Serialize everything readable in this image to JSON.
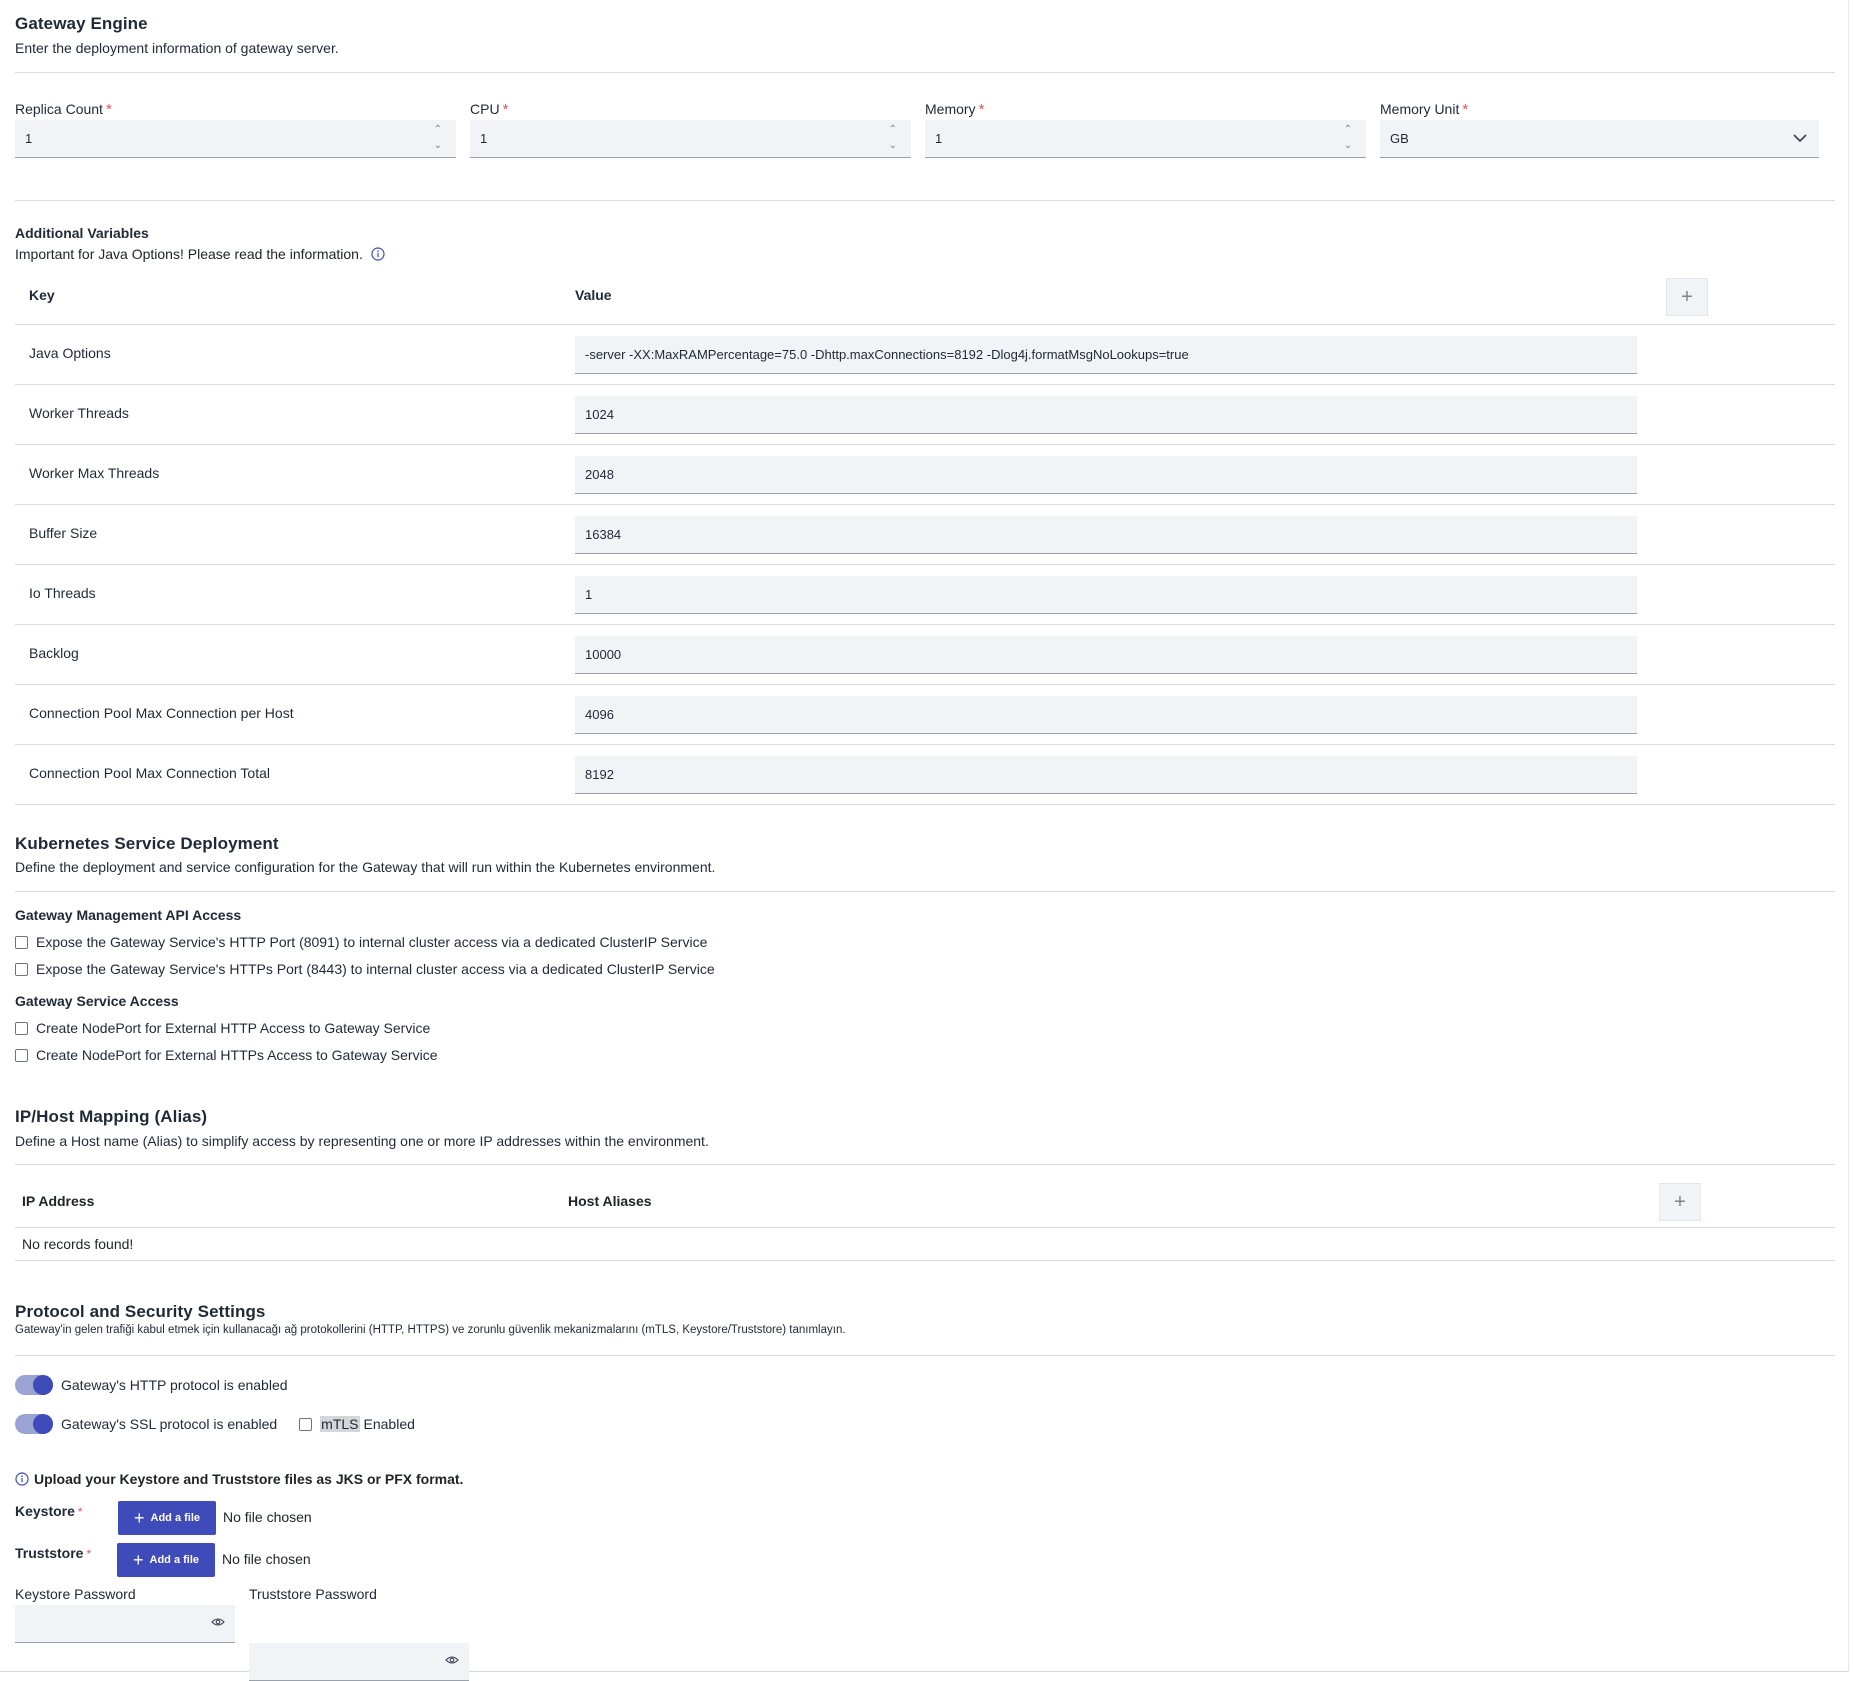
{
  "gateway_engine": {
    "title": "Gateway Engine",
    "subtitle": "Enter the deployment information of gateway server.",
    "fields": [
      {
        "label": "Replica Count",
        "required": "*",
        "value": "1"
      },
      {
        "label": "CPU",
        "required": "*",
        "value": "1"
      },
      {
        "label": "Memory",
        "required": "*",
        "value": "1"
      },
      {
        "label": "Memory Unit",
        "required": "*",
        "value": "GB"
      }
    ]
  },
  "additional_variables": {
    "title": "Additional Variables",
    "info": "Important for Java Options! Please read the information.",
    "col_key": "Key",
    "col_value": "Value",
    "rows": [
      {
        "key": "Java Options",
        "value": "-server -XX:MaxRAMPercentage=75.0 -Dhttp.maxConnections=8192 -Dlog4j.formatMsgNoLookups=true"
      },
      {
        "key": "Worker Threads",
        "value": "1024"
      },
      {
        "key": "Worker Max Threads",
        "value": "2048"
      },
      {
        "key": "Buffer Size",
        "value": "16384"
      },
      {
        "key": "Io Threads",
        "value": "1"
      },
      {
        "key": "Backlog",
        "value": "10000"
      },
      {
        "key": "Connection Pool Max Connection per Host",
        "value": "4096"
      },
      {
        "key": "Connection Pool Max Connection Total",
        "value": "8192"
      }
    ]
  },
  "k8s": {
    "title": "Kubernetes Service Deployment",
    "subtitle": "Define the deployment and service configuration for the Gateway that will run within the Kubernetes environment.",
    "mgmt_title": "Gateway Management API Access",
    "mgmt_http": "Expose the Gateway Service's HTTP Port (8091) to internal cluster access via a dedicated ClusterIP Service",
    "mgmt_https": "Expose the Gateway Service's HTTPs Port (8443) to internal cluster access via a dedicated ClusterIP Service",
    "svc_title": "Gateway Service Access",
    "svc_http": "Create NodePort for External HTTP Access to Gateway Service",
    "svc_https": "Create NodePort for External HTTPs Access to Gateway Service"
  },
  "ip_mapping": {
    "title": "IP/Host Mapping (Alias)",
    "subtitle": "Define a Host name (Alias) to simplify access by representing one or more IP addresses within the environment.",
    "col_ip": "IP Address",
    "col_host": "Host Aliases",
    "empty": "No records found!"
  },
  "protocol": {
    "title": "Protocol and Security Settings",
    "subtitle": "Gateway'in gelen trafiği kabul etmek için kullanacağı ağ protokollerini (HTTP, HTTPS) ve zorunlu güvenlik mekanizmalarını (mTLS, Keystore/Truststore) tanımlayın.",
    "http_label": "Gateway's HTTP protocol is enabled",
    "ssl_label": "Gateway's SSL protocol is enabled",
    "mtls_prefix": "mTLS",
    "mtls_suffix": "Enabled",
    "upload_info": "Upload your Keystore and Truststore files as JKS or PFX format.",
    "keystore_label": "Keystore",
    "truststore_label": "Truststore",
    "required": "*",
    "add_file": "Add a file",
    "no_file": "No file chosen",
    "keystore_password": "Keystore Password",
    "truststore_password": "Truststore Password",
    "http_enabled": true,
    "ssl_enabled": true
  },
  "colors": {
    "accent": "#3e4bb8",
    "required": "#e55353",
    "input_bg": "#f1f3f7"
  }
}
